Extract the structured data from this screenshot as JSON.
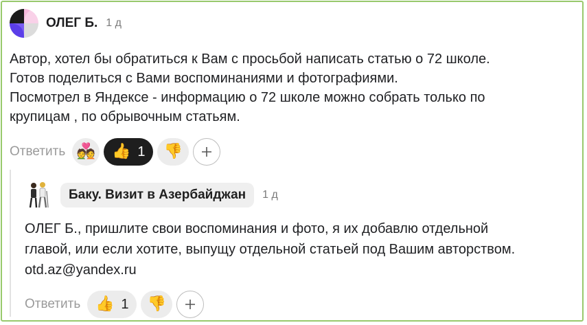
{
  "comment": {
    "author": "ОЛЕГ Б.",
    "time": "1 д",
    "lines": [
      "Автор, хотел бы обратиться к Вам с просьбой написать статью о 72 школе.",
      "Готов поделиться с Вами воспоминаниями и фотографиями.",
      "Посмотрел в Яндексе - информацию о 72 школе можно собрать только по",
      "крупицам , по обрывочным статьям."
    ],
    "reply_label": "Ответить",
    "reactions": {
      "love_emoji": "💑",
      "like_emoji": "👍",
      "like_count": "1",
      "dislike_emoji": "👎"
    }
  },
  "reply": {
    "author": "Баку. Визит в Азербайджан",
    "time": "1 д",
    "lines": [
      "ОЛЕГ Б., пришлите свои воспоминания и фото, я их добавлю отдельной",
      "главой, или если хотите, выпущу отдельной статьей под Вашим авторством.",
      "otd.az@yandex.ru"
    ],
    "reply_label": "Ответить",
    "reactions": {
      "like_emoji": "👍",
      "like_count": "1",
      "dislike_emoji": "👎"
    }
  },
  "colors": {
    "frame_border": "#98c96c",
    "active_reaction_bg": "#1e1e1e",
    "reaction_bg": "#ececec",
    "muted_text": "#9a9a9a"
  }
}
